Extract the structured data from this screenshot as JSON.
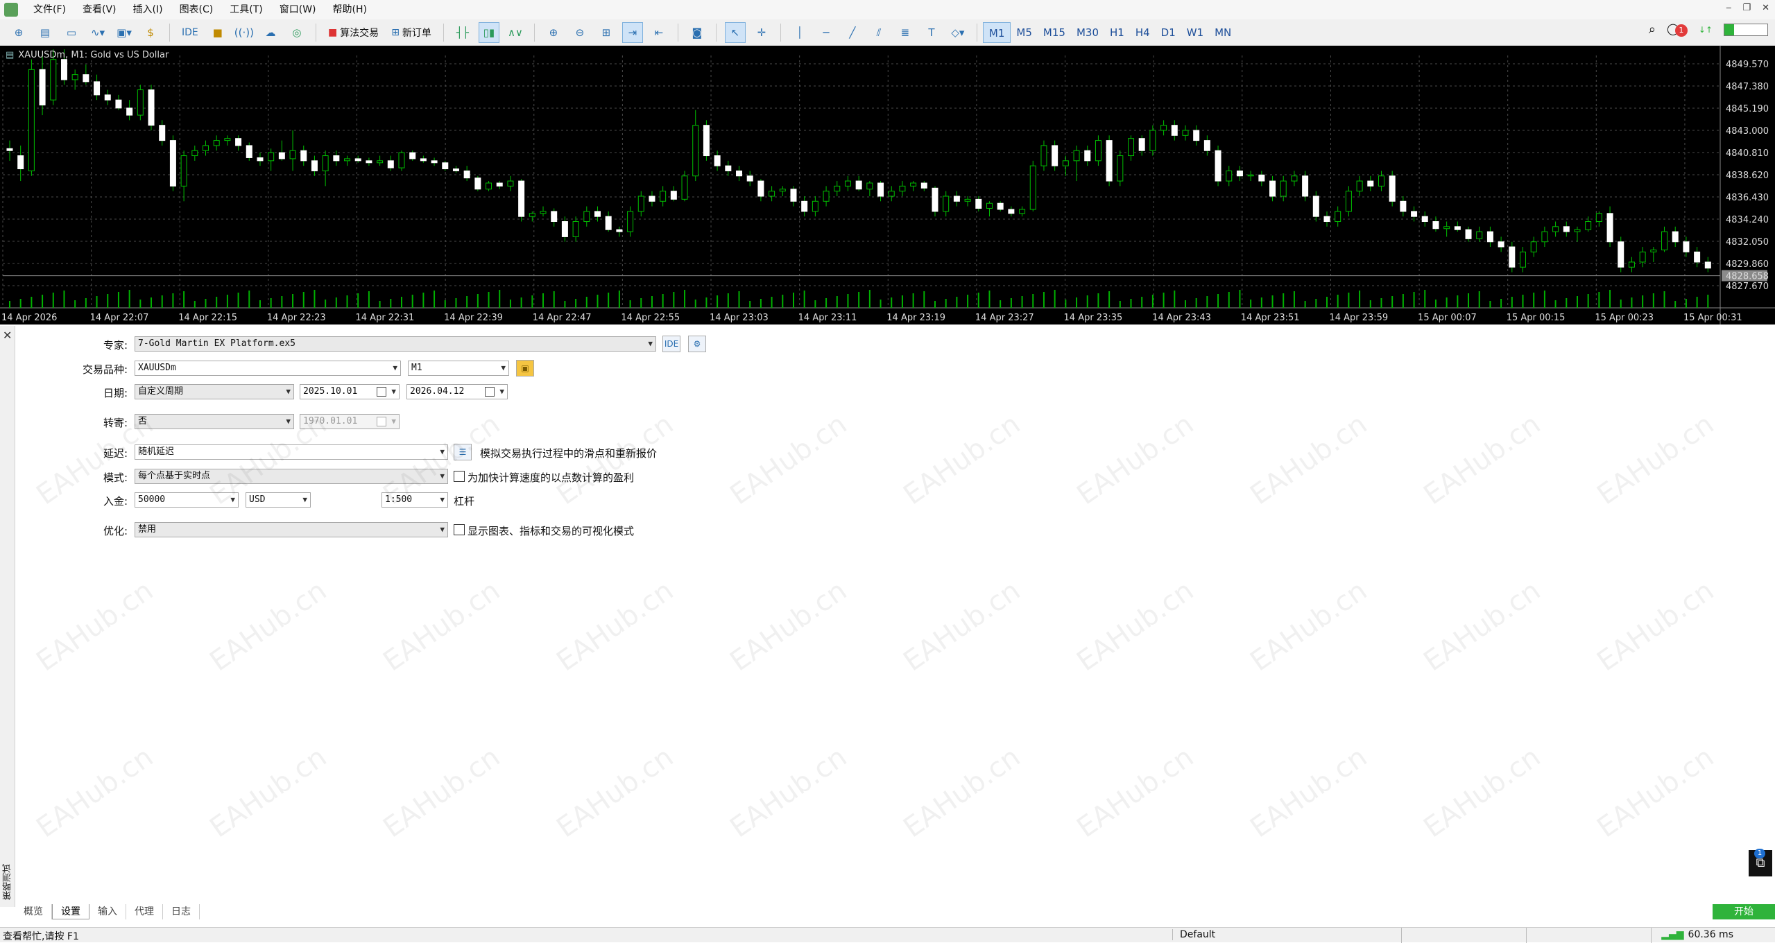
{
  "menu": [
    "文件(F)",
    "查看(V)",
    "插入(I)",
    "图表(C)",
    "工具(T)",
    "窗口(W)",
    "帮助(H)"
  ],
  "toolbar": {
    "ide_label": "IDE",
    "algo_label": "算法交易",
    "new_order_label": "新订单",
    "timeframes": [
      "M1",
      "M5",
      "M15",
      "M30",
      "H1",
      "H4",
      "D1",
      "W1",
      "MN"
    ],
    "active_timeframe": "M1",
    "notification_count": "1"
  },
  "chart": {
    "title": "XAUUSDm, M1:  Gold vs US Dollar",
    "price_labels": [
      "4849.570",
      "4847.380",
      "4845.190",
      "4843.000",
      "4840.810",
      "4838.620",
      "4836.430",
      "4834.240",
      "4832.050",
      "4829.860",
      "4828.658",
      "4827.670"
    ],
    "current_price": "4828.658",
    "time_labels": [
      "14 Apr 2026",
      "14 Apr 22:07",
      "14 Apr 22:15",
      "14 Apr 22:23",
      "14 Apr 22:31",
      "14 Apr 22:39",
      "14 Apr 22:47",
      "14 Apr 22:55",
      "14 Apr 23:03",
      "14 Apr 23:11",
      "14 Apr 23:19",
      "14 Apr 23:27",
      "14 Apr 23:35",
      "14 Apr 23:43",
      "14 Apr 23:51",
      "14 Apr 23:59",
      "15 Apr 00:07",
      "15 Apr 00:15",
      "15 Apr 00:23",
      "15 Apr 00:31"
    ],
    "candles": [
      [
        4841.2,
        4842.0,
        4840.0,
        4841.0
      ],
      [
        4840.5,
        4841.5,
        4838.0,
        4839.2
      ],
      [
        4839.0,
        4850.0,
        4838.5,
        4849.0
      ],
      [
        4849.0,
        4850.5,
        4844.5,
        4845.5
      ],
      [
        4846.0,
        4851.0,
        4845.5,
        4850.0
      ],
      [
        4850.0,
        4851.0,
        4847.5,
        4848.0
      ],
      [
        4848.0,
        4849.0,
        4847.0,
        4848.5
      ],
      [
        4848.5,
        4849.5,
        4847.5,
        4847.8
      ],
      [
        4847.8,
        4848.5,
        4846.0,
        4846.5
      ],
      [
        4846.5,
        4847.0,
        4845.5,
        4846.0
      ],
      [
        4846.0,
        4846.5,
        4845.0,
        4845.2
      ],
      [
        4845.2,
        4846.0,
        4844.0,
        4844.5
      ],
      [
        4844.5,
        4847.5,
        4844.0,
        4847.0
      ],
      [
        4847.0,
        4847.5,
        4843.0,
        4843.5
      ],
      [
        4843.5,
        4844.0,
        4841.5,
        4842.0
      ],
      [
        4842.0,
        4842.5,
        4837.0,
        4837.5
      ],
      [
        4837.5,
        4841.0,
        4836.0,
        4840.5
      ],
      [
        4840.5,
        4841.5,
        4840.0,
        4841.0
      ],
      [
        4841.0,
        4842.0,
        4840.5,
        4841.5
      ],
      [
        4841.5,
        4842.5,
        4841.0,
        4842.0
      ],
      [
        4842.0,
        4842.5,
        4841.5,
        4842.2
      ],
      [
        4842.2,
        4842.5,
        4841.0,
        4841.5
      ],
      [
        4841.5,
        4841.8,
        4840.0,
        4840.3
      ],
      [
        4840.3,
        4840.8,
        4839.5,
        4840.0
      ],
      [
        4840.0,
        4841.2,
        4839.0,
        4840.8
      ],
      [
        4840.8,
        4842.0,
        4840.0,
        4840.2
      ],
      [
        4840.2,
        4843.0,
        4839.0,
        4841.0
      ],
      [
        4841.0,
        4841.5,
        4839.5,
        4840.0
      ],
      [
        4840.0,
        4840.5,
        4838.5,
        4839.0
      ],
      [
        4839.0,
        4841.0,
        4837.5,
        4840.5
      ],
      [
        4840.5,
        4841.0,
        4839.5,
        4840.0
      ],
      [
        4840.0,
        4840.5,
        4839.5,
        4840.2
      ],
      [
        4840.2,
        4840.5,
        4839.8,
        4840.0
      ],
      [
        4840.0,
        4840.3,
        4839.5,
        4839.8
      ],
      [
        4839.8,
        4840.5,
        4839.5,
        4840.0
      ],
      [
        4840.0,
        4840.5,
        4839.0,
        4839.3
      ],
      [
        4839.3,
        4841.0,
        4839.0,
        4840.8
      ],
      [
        4840.8,
        4841.0,
        4840.0,
        4840.2
      ],
      [
        4840.2,
        4840.5,
        4839.8,
        4840.0
      ],
      [
        4840.0,
        4840.3,
        4839.5,
        4839.8
      ],
      [
        4839.8,
        4840.0,
        4839.0,
        4839.2
      ],
      [
        4839.2,
        4839.5,
        4838.8,
        4839.0
      ],
      [
        4839.0,
        4839.5,
        4838.0,
        4838.3
      ],
      [
        4838.3,
        4838.5,
        4837.0,
        4837.2
      ],
      [
        4837.2,
        4838.0,
        4837.0,
        4837.8
      ],
      [
        4837.8,
        4838.0,
        4837.2,
        4837.5
      ],
      [
        4837.5,
        4838.5,
        4837.0,
        4838.0
      ],
      [
        4838.0,
        4838.2,
        4834.0,
        4834.5
      ],
      [
        4834.5,
        4835.0,
        4834.0,
        4834.8
      ],
      [
        4834.8,
        4835.5,
        4834.5,
        4835.0
      ],
      [
        4835.0,
        4835.3,
        4833.5,
        4834.0
      ],
      [
        4834.0,
        4834.5,
        4832.0,
        4832.5
      ],
      [
        4832.5,
        4834.5,
        4832.0,
        4834.0
      ],
      [
        4834.0,
        4835.5,
        4833.5,
        4835.0
      ],
      [
        4835.0,
        4835.5,
        4834.0,
        4834.5
      ],
      [
        4834.5,
        4835.0,
        4833.0,
        4833.2
      ],
      [
        4833.2,
        4833.5,
        4832.5,
        4833.0
      ],
      [
        4833.0,
        4835.5,
        4832.5,
        4835.0
      ],
      [
        4835.0,
        4837.0,
        4834.5,
        4836.5
      ],
      [
        4836.5,
        4837.0,
        4835.5,
        4836.0
      ],
      [
        4836.0,
        4837.5,
        4835.5,
        4837.0
      ],
      [
        4837.0,
        4837.5,
        4836.0,
        4836.2
      ],
      [
        4836.2,
        4839.0,
        4836.0,
        4838.5
      ],
      [
        4838.5,
        4845.0,
        4838.0,
        4843.5
      ],
      [
        4843.5,
        4844.0,
        4840.0,
        4840.5
      ],
      [
        4840.5,
        4841.0,
        4839.0,
        4839.5
      ],
      [
        4839.5,
        4840.0,
        4838.5,
        4839.0
      ],
      [
        4839.0,
        4839.5,
        4838.0,
        4838.5
      ],
      [
        4838.5,
        4839.0,
        4837.5,
        4838.0
      ],
      [
        4838.0,
        4838.2,
        4836.0,
        4836.5
      ],
      [
        4836.5,
        4837.5,
        4836.0,
        4837.0
      ],
      [
        4837.0,
        4837.5,
        4836.5,
        4837.2
      ],
      [
        4837.2,
        4837.5,
        4835.5,
        4836.0
      ],
      [
        4836.0,
        4836.5,
        4834.5,
        4835.0
      ],
      [
        4835.0,
        4836.5,
        4834.5,
        4836.0
      ],
      [
        4836.0,
        4837.5,
        4835.5,
        4837.0
      ],
      [
        4837.0,
        4838.0,
        4836.5,
        4837.5
      ],
      [
        4837.5,
        4838.5,
        4837.0,
        4838.0
      ],
      [
        4838.0,
        4838.5,
        4837.0,
        4837.2
      ],
      [
        4837.2,
        4838.0,
        4836.5,
        4837.8
      ],
      [
        4837.8,
        4838.0,
        4836.0,
        4836.5
      ],
      [
        4836.5,
        4837.5,
        4836.0,
        4837.0
      ],
      [
        4837.0,
        4838.0,
        4836.5,
        4837.5
      ],
      [
        4837.5,
        4838.0,
        4837.0,
        4837.8
      ],
      [
        4837.8,
        4838.0,
        4837.0,
        4837.3
      ],
      [
        4837.3,
        4837.5,
        4834.5,
        4835.0
      ],
      [
        4835.0,
        4837.0,
        4834.5,
        4836.5
      ],
      [
        4836.5,
        4837.0,
        4835.5,
        4836.0
      ],
      [
        4836.0,
        4836.5,
        4835.5,
        4836.2
      ],
      [
        4836.2,
        4836.5,
        4835.0,
        4835.3
      ],
      [
        4835.3,
        4836.0,
        4834.5,
        4835.8
      ],
      [
        4835.8,
        4836.0,
        4835.0,
        4835.2
      ],
      [
        4835.2,
        4835.5,
        4834.5,
        4834.8
      ],
      [
        4834.8,
        4835.5,
        4834.5,
        4835.2
      ],
      [
        4835.2,
        4840.0,
        4835.0,
        4839.5
      ],
      [
        4839.5,
        4842.0,
        4839.0,
        4841.5
      ],
      [
        4841.5,
        4842.0,
        4839.0,
        4839.5
      ],
      [
        4839.5,
        4840.5,
        4838.5,
        4840.0
      ],
      [
        4840.0,
        4841.5,
        4838.0,
        4841.0
      ],
      [
        4841.0,
        4841.5,
        4839.5,
        4840.0
      ],
      [
        4840.0,
        4842.5,
        4839.5,
        4842.0
      ],
      [
        4842.0,
        4842.5,
        4837.5,
        4838.0
      ],
      [
        4838.0,
        4841.0,
        4837.5,
        4840.5
      ],
      [
        4840.5,
        4842.5,
        4840.0,
        4842.2
      ],
      [
        4842.2,
        4842.5,
        4840.5,
        4841.0
      ],
      [
        4841.0,
        4843.5,
        4840.5,
        4843.0
      ],
      [
        4843.0,
        4844.0,
        4842.5,
        4843.5
      ],
      [
        4843.5,
        4844.0,
        4842.0,
        4842.5
      ],
      [
        4842.5,
        4843.5,
        4842.0,
        4843.0
      ],
      [
        4843.0,
        4843.5,
        4841.5,
        4842.0
      ],
      [
        4842.0,
        4842.5,
        4840.5,
        4841.0
      ],
      [
        4841.0,
        4841.5,
        4837.5,
        4838.0
      ],
      [
        4838.0,
        4839.5,
        4837.5,
        4839.0
      ],
      [
        4839.0,
        4839.5,
        4838.0,
        4838.5
      ],
      [
        4838.5,
        4839.0,
        4838.0,
        4838.6
      ],
      [
        4838.6,
        4839.0,
        4837.5,
        4838.0
      ],
      [
        4838.0,
        4838.5,
        4836.0,
        4836.5
      ],
      [
        4836.5,
        4838.5,
        4836.0,
        4838.0
      ],
      [
        4838.0,
        4839.0,
        4837.5,
        4838.5
      ],
      [
        4838.5,
        4839.0,
        4836.0,
        4836.5
      ],
      [
        4836.5,
        4837.0,
        4834.0,
        4834.5
      ],
      [
        4834.5,
        4835.0,
        4833.5,
        4834.0
      ],
      [
        4834.0,
        4835.5,
        4833.5,
        4835.0
      ],
      [
        4835.0,
        4837.5,
        4834.5,
        4837.0
      ],
      [
        4837.0,
        4838.5,
        4836.5,
        4838.0
      ],
      [
        4838.0,
        4838.5,
        4837.0,
        4837.5
      ],
      [
        4837.5,
        4839.0,
        4837.0,
        4838.5
      ],
      [
        4838.5,
        4839.0,
        4835.5,
        4836.0
      ],
      [
        4836.0,
        4836.5,
        4834.5,
        4835.0
      ],
      [
        4835.0,
        4835.5,
        4834.0,
        4834.5
      ],
      [
        4834.5,
        4835.0,
        4833.5,
        4834.0
      ],
      [
        4834.0,
        4834.5,
        4833.0,
        4833.3
      ],
      [
        4833.3,
        4834.0,
        4832.5,
        4833.5
      ],
      [
        4833.5,
        4834.0,
        4833.0,
        4833.2
      ],
      [
        4833.2,
        4833.5,
        4832.0,
        4832.3
      ],
      [
        4832.3,
        4833.5,
        4832.0,
        4833.0
      ],
      [
        4833.0,
        4833.5,
        4831.5,
        4832.0
      ],
      [
        4832.0,
        4832.5,
        4831.0,
        4831.5
      ],
      [
        4831.5,
        4832.0,
        4829.0,
        4829.5
      ],
      [
        4829.5,
        4831.5,
        4829.0,
        4831.0
      ],
      [
        4831.0,
        4832.5,
        4830.5,
        4832.0
      ],
      [
        4832.0,
        4833.5,
        4831.5,
        4833.0
      ],
      [
        4833.0,
        4834.0,
        4832.5,
        4833.5
      ],
      [
        4833.5,
        4834.0,
        4832.5,
        4833.0
      ],
      [
        4833.0,
        4833.5,
        4832.0,
        4833.2
      ],
      [
        4833.2,
        4834.5,
        4833.0,
        4834.0
      ],
      [
        4834.0,
        4835.0,
        4833.5,
        4834.8
      ],
      [
        4834.8,
        4835.5,
        4831.5,
        4832.0
      ],
      [
        4832.0,
        4832.5,
        4829.0,
        4829.5
      ],
      [
        4829.5,
        4830.5,
        4829.0,
        4830.0
      ],
      [
        4830.0,
        4831.5,
        4829.5,
        4831.0
      ],
      [
        4831.0,
        4831.5,
        4830.0,
        4831.2
      ],
      [
        4831.2,
        4833.5,
        4831.0,
        4833.0
      ],
      [
        4833.0,
        4833.5,
        4831.5,
        4832.0
      ],
      [
        4832.0,
        4832.5,
        4830.5,
        4831.0
      ],
      [
        4831.0,
        4831.5,
        4829.5,
        4830.0
      ],
      [
        4830.0,
        4830.5,
        4829.0,
        4829.4
      ]
    ]
  },
  "settings": {
    "expert": {
      "label": "专家:",
      "value": "7-Gold Martin EX Platform.ex5"
    },
    "symbol": {
      "label": "交易品种:",
      "value": "XAUUSDm",
      "timeframe": "M1"
    },
    "date": {
      "label": "日期:",
      "period": "自定义周期",
      "from": "2025.10.01",
      "to": "2026.04.12"
    },
    "forward": {
      "label": "转寄:",
      "value": "否",
      "date": "1970.01.01"
    },
    "delay": {
      "label": "延迟:",
      "value": "随机延迟",
      "checkbox_label": "模拟交易执行过程中的滑点和重新报价"
    },
    "model": {
      "label": "模式:",
      "value": "每个点基于实时点",
      "checkbox_label": "为加快计算速度的以点数计算的盈利"
    },
    "deposit": {
      "label": "入金:",
      "value": "50000",
      "currency": "USD",
      "leverage": "1:500",
      "leverage_label": "杠杆"
    },
    "optimization": {
      "label": "优化:",
      "value": "禁用",
      "checkbox_label": "显示图表、指标和交易的可视化模式"
    }
  },
  "side_panel": {
    "vertical_title": "策略测试"
  },
  "tabs": [
    "概览",
    "设置",
    "输入",
    "代理",
    "日志"
  ],
  "active_tab": "设置",
  "start_button": "开始",
  "status": {
    "help": "查看帮忙,请按 F1",
    "profile": "Default",
    "ping": "60.36 ms"
  },
  "watermark": "EAHub.cn",
  "side_badge": "1",
  "colors": {
    "bull": "#ffffff",
    "bear": "#ffffff",
    "wick": "#00c000",
    "grid": "#4a4a4a",
    "start": "#2fb33b"
  }
}
